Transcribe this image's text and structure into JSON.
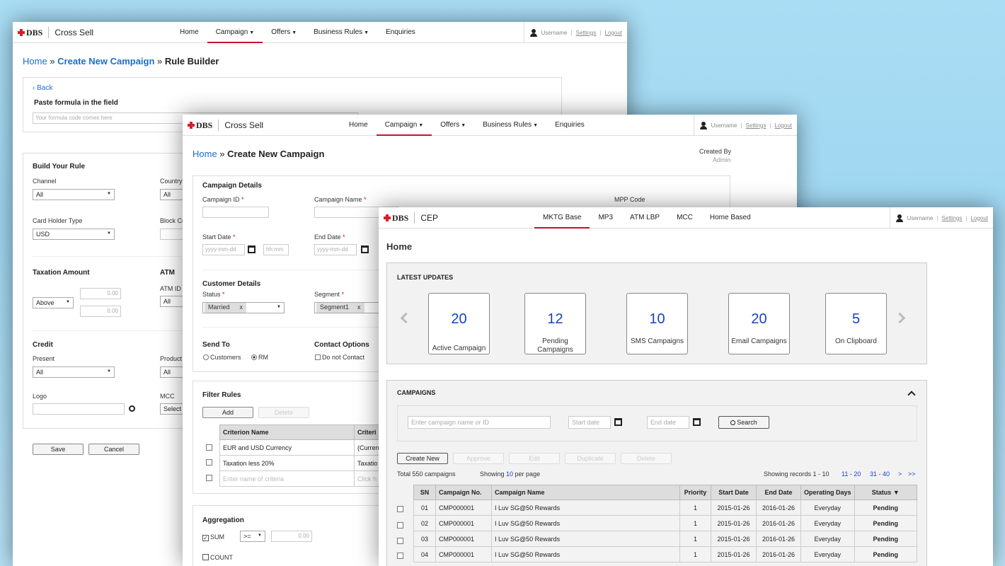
{
  "brand": {
    "logo": "DBS",
    "logo_color": "#d81e2c",
    "accent": "#c8102e",
    "link_color": "#1a6fc9"
  },
  "user": {
    "name": "Username",
    "settings": "Settings",
    "logout": "Logout"
  },
  "rule_builder": {
    "app_name": "Cross Sell",
    "nav": [
      "Home",
      "Campaign",
      "Offers",
      "Business Rules",
      "Enquiries"
    ],
    "breadcrumb": {
      "home": "Home",
      "sep": " » ",
      "create": "Create New Campaign",
      "current": "Rule Builder"
    },
    "back": "‹ Back",
    "paste_label": "Paste formula in the field",
    "formula_placeholder": "Your formula code comes here",
    "build_title": "Build Your Rule",
    "channel_label": "Channel",
    "channel_value": "All",
    "country_label": "Country",
    "country_value": "All",
    "card_holder_label": "Card Holder Type",
    "card_holder_value": "USD",
    "block_label": "Block Co",
    "taxation_title": "Taxation Amount",
    "taxation_op": "Above",
    "tax_min": "0.00",
    "tax_max": "0.00",
    "atm_title": "ATM",
    "atm_id_label": "ATM ID",
    "atm_id_value": "All",
    "credit_title": "Credit",
    "present_label": "Present",
    "present_value": "All",
    "product_label": "Product",
    "product_value": "All",
    "logo_label": "Logo",
    "mcc_label": "MCC",
    "mcc_value": "Select",
    "save": "Save",
    "cancel": "Cancel"
  },
  "create_campaign": {
    "app_name": "Cross Sell",
    "nav": [
      "Home",
      "Campaign",
      "Offers",
      "Business Rules",
      "Enquiries"
    ],
    "breadcrumb": {
      "home": "Home",
      "sep": " » ",
      "current": "Create New Campaign"
    },
    "created_by_label": "Created By",
    "created_by_value": "Admin",
    "details_title": "Campaign Details",
    "campaign_id_label": "Campaign ID",
    "campaign_name_label": "Campaign  Name",
    "mpp_label": "MPP Code",
    "start_date_label": "Start Date",
    "end_date_label": "End Date",
    "date_placeholder": "yyyy-mm-dd",
    "time_placeholder": "hh:mm",
    "customer_title": "Customer Details",
    "status_label": "Status",
    "status_chip": "Married",
    "segment_label": "Segment",
    "segment_chip": "Segment1",
    "send_to_title": "Send To",
    "send_customers": "Customers",
    "send_rm": "RM",
    "contact_title": "Contact Options",
    "do_not_contact": "Do not Contact",
    "filter_title": "Filter Rules",
    "add": "Add",
    "delete": "Delete",
    "criterion_header": "Criterion Name",
    "criteria_header": "Criteri",
    "criteria_rows": [
      {
        "name": "EUR and USD Currency",
        "value": "(Curren"
      },
      {
        "name": "Taxation less 20%",
        "value": "Taxatio"
      },
      {
        "name": "Enter name of criteria",
        "value": "Click h"
      }
    ],
    "aggregation_title": "Aggregation",
    "sum_label": "SUM",
    "sum_op": ">=",
    "sum_value": "0.00",
    "count_label": "COUNT"
  },
  "cep": {
    "app_name": "CEP",
    "nav": [
      "MKTG Base",
      "MP3",
      "ATM LBP",
      "MCC",
      "Home Based"
    ],
    "page_title": "Home",
    "latest_title": "LATEST UPDATES",
    "cards": [
      {
        "value": "20",
        "label": "Active Campaign"
      },
      {
        "value": "12",
        "label": "Pending Campaigns"
      },
      {
        "value": "10",
        "label": "SMS Campaigns"
      },
      {
        "value": "20",
        "label": "Email Campaigns"
      },
      {
        "value": "5",
        "label": "On Clipboard"
      }
    ],
    "campaigns_title": "CAMPAIGNS",
    "search_placeholder": "Enter campaign name or ID",
    "start_placeholder": "Start date",
    "end_placeholder": "End date",
    "search_btn": "Search",
    "actions": [
      "Create New",
      "Approve",
      "Edit",
      "Duplicate",
      "Delete"
    ],
    "total": "Total 550 campaigns",
    "showing_pre": "Showing ",
    "showing_num": "10",
    "showing_post": " per page",
    "records": "Showing records 1 - 10",
    "pages": [
      "11 - 20",
      "31 - 40",
      ">",
      ">>"
    ],
    "columns": [
      "SN",
      "Campaign No.",
      "Campaign Name",
      "Priority",
      "Start Date",
      "End Date",
      "Operating Days",
      "Status"
    ],
    "rows": [
      [
        "01",
        "CMP000001",
        "I Luv SG@50 Rewards",
        "1",
        "2015-01-26",
        "2016-01-26",
        "Everyday",
        "Pending"
      ],
      [
        "02",
        "CMP000001",
        "I Luv SG@50 Rewards",
        "1",
        "2015-01-26",
        "2016-01-26",
        "Everyday",
        "Pending"
      ],
      [
        "03",
        "CMP000001",
        "I Luv SG@50 Rewards",
        "1",
        "2015-01-26",
        "2016-01-26",
        "Everyday",
        "Pending"
      ],
      [
        "04",
        "CMP000001",
        "I Luv SG@50 Rewards",
        "1",
        "2015-01-26",
        "2016-01-26",
        "Everyday",
        "Pending"
      ]
    ]
  }
}
